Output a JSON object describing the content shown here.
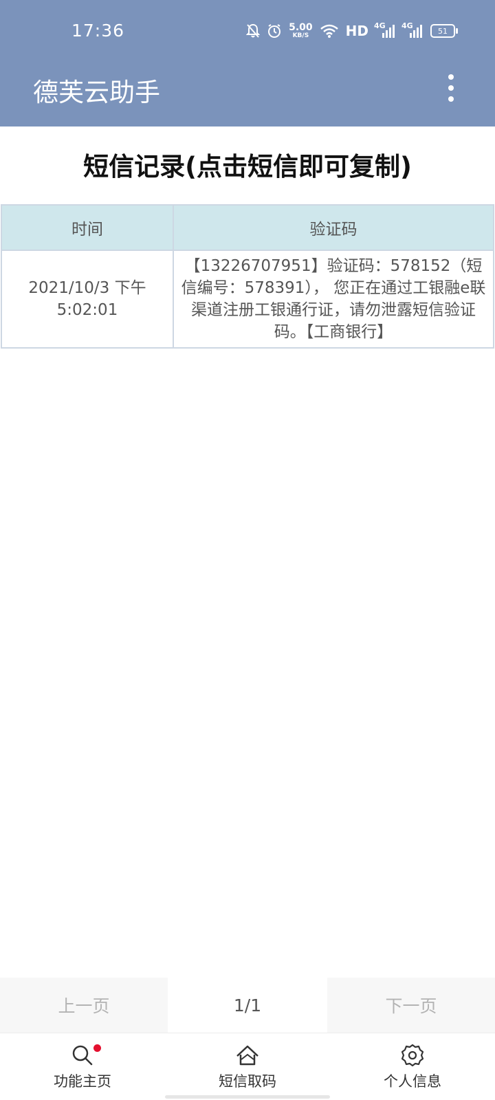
{
  "status_bar": {
    "time": "17:36",
    "net_speed_value": "5.00",
    "net_speed_unit": "KB/S",
    "hd_label": "HD",
    "sim1_tag": "4G",
    "sim2_tag": "4G",
    "battery": "51"
  },
  "app_bar": {
    "title": "德芙云助手"
  },
  "page": {
    "title": "短信记录(点击短信即可复制)"
  },
  "table": {
    "headers": {
      "time": "时间",
      "code": "验证码"
    },
    "rows": [
      {
        "time": "2021/10/3 下午5:02:01",
        "message": "【13226707951】验证码：578152（短信编号：578391）， 您正在通过工银融e联渠道注册工银通行证，请勿泄露短信验证码。【工商银行】"
      }
    ]
  },
  "pagination": {
    "prev_label": "上一页",
    "page_indicator": "1/1",
    "next_label": "下一页"
  },
  "bottom_nav": {
    "items": [
      {
        "label": "功能主页",
        "icon": "search-icon"
      },
      {
        "label": "短信取码",
        "icon": "home-icon"
      },
      {
        "label": "个人信息",
        "icon": "gear-icon"
      }
    ]
  },
  "colors": {
    "app_bar": "#7b93bb",
    "table_header": "#cfe7ec",
    "badge": "#e4102f"
  }
}
